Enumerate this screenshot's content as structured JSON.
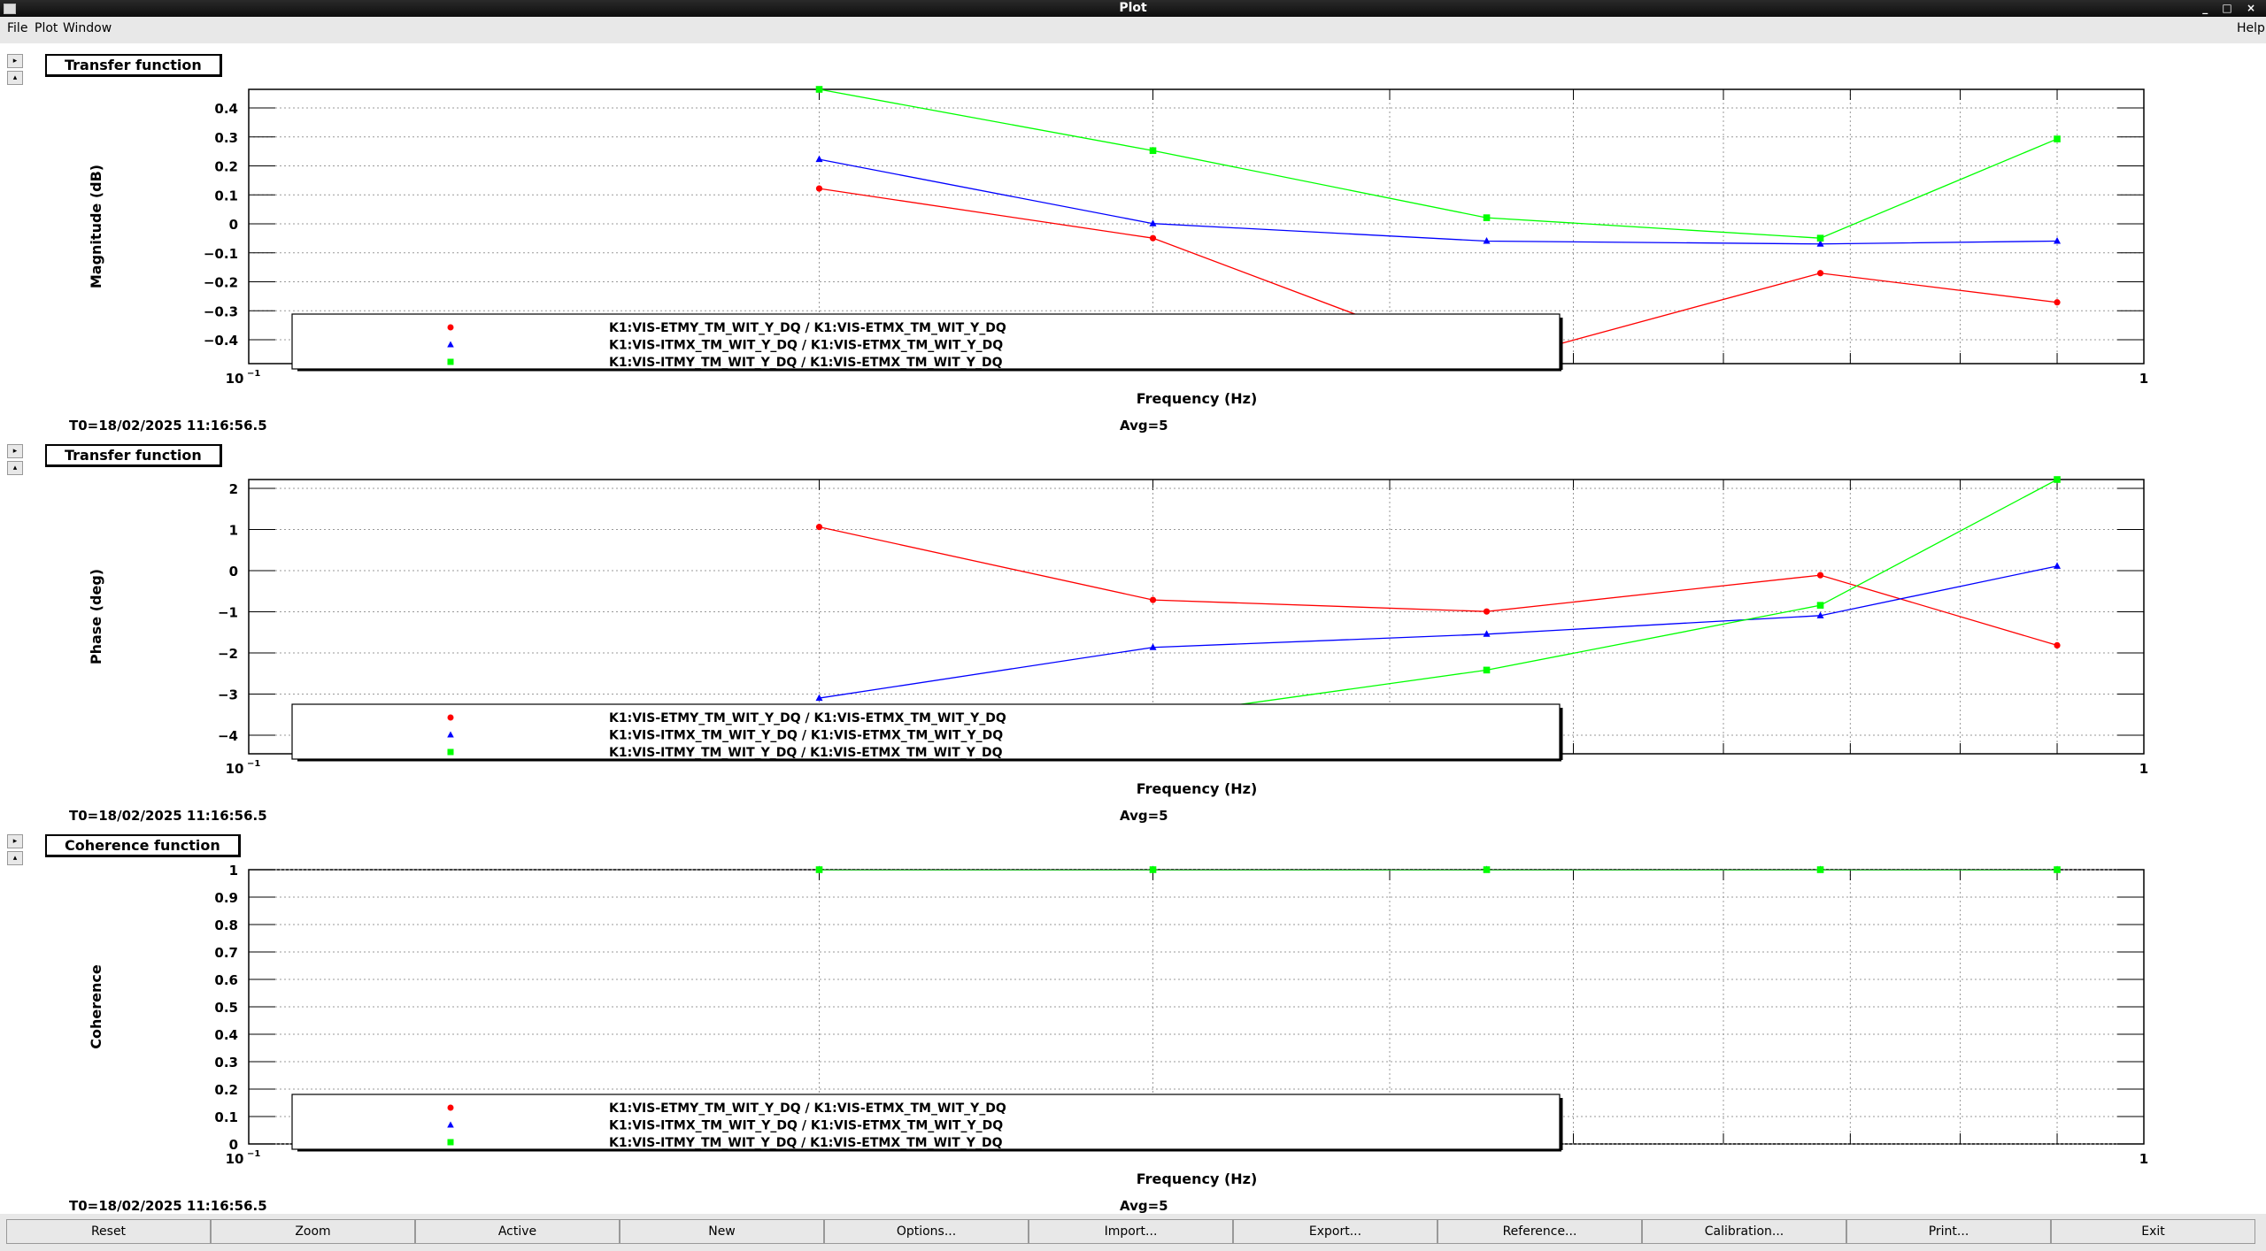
{
  "window": {
    "title": "Plot",
    "controls": "_ □ ×"
  },
  "menu": {
    "file": "File",
    "plot": "Plot",
    "window": "Window",
    "help": "Help"
  },
  "panels": [
    {
      "title": "Transfer function",
      "ylabel": "Magnitude (dB)",
      "xlabel": "Frequency (Hz)",
      "t0": "T0=18/02/2025 11:16:56.5",
      "avg": "Avg=5",
      "yticks": [
        "0.4",
        "0.3",
        "0.2",
        "0.1",
        "0",
        "−0.1",
        "−0.2",
        "−0.3",
        "−0.4"
      ]
    },
    {
      "title": "Transfer function",
      "ylabel": "Phase (deg)",
      "xlabel": "Frequency (Hz)",
      "t0": "T0=18/02/2025 11:16:56.5",
      "avg": "Avg=5",
      "yticks": [
        "2",
        "1",
        "0",
        "−1",
        "−2",
        "−3",
        "−4"
      ]
    },
    {
      "title": "Coherence function",
      "ylabel": "Coherence",
      "xlabel": "Frequency (Hz)",
      "t0": "T0=18/02/2025 11:16:56.5",
      "avg": "Avg=5",
      "yticks": [
        "1",
        "0.9",
        "0.8",
        "0.7",
        "0.6",
        "0.5",
        "0.4",
        "0.3",
        "0.2",
        "0.1",
        "0"
      ]
    }
  ],
  "legend": [
    "K1:VIS-ETMY_TM_WIT_Y_DQ / K1:VIS-ETMX_TM_WIT_Y_DQ",
    "K1:VIS-ITMX_TM_WIT_Y_DQ / K1:VIS-ETMX_TM_WIT_Y_DQ",
    "K1:VIS-ITMY_TM_WIT_Y_DQ / K1:VIS-ETMX_TM_WIT_Y_DQ"
  ],
  "xticks": {
    "left": "10",
    "left_exp": "−1",
    "right": "1"
  },
  "colors": {
    "red": "#ff0000",
    "blue": "#0000ff",
    "green": "#00ff00"
  },
  "chart_data": [
    {
      "type": "line",
      "title": "Transfer function",
      "xlabel": "Frequency (Hz)",
      "ylabel": "Magnitude (dB)",
      "xscale": "log",
      "xlim": [
        0.1,
        1
      ],
      "ylim": [
        -0.48,
        0.46
      ],
      "grid": true,
      "legend": "bottom-left",
      "x": [
        0.2,
        0.3,
        0.45,
        0.675,
        0.9
      ],
      "series": [
        {
          "name": "K1:VIS-ETMY_TM_WIT_Y_DQ / K1:VIS-ETMX_TM_WIT_Y_DQ",
          "color": "#ff0000",
          "marker": "circle",
          "values": [
            0.12,
            -0.05,
            -0.48,
            -0.17,
            -0.27
          ]
        },
        {
          "name": "K1:VIS-ITMX_TM_WIT_Y_DQ / K1:VIS-ETMX_TM_WIT_Y_DQ",
          "color": "#0000ff",
          "marker": "triangle",
          "values": [
            0.22,
            0.0,
            -0.06,
            -0.07,
            -0.06
          ]
        },
        {
          "name": "K1:VIS-ITMY_TM_WIT_Y_DQ / K1:VIS-ETMX_TM_WIT_Y_DQ",
          "color": "#00ff00",
          "marker": "square",
          "values": [
            0.46,
            0.25,
            0.02,
            -0.05,
            0.29
          ]
        }
      ]
    },
    {
      "type": "line",
      "title": "Transfer function",
      "xlabel": "Frequency (Hz)",
      "ylabel": "Phase (deg)",
      "xscale": "log",
      "xlim": [
        0.1,
        1
      ],
      "ylim": [
        -4,
        2.65
      ],
      "grid": true,
      "legend": "bottom-left",
      "x": [
        0.2,
        0.3,
        0.45,
        0.675,
        0.9
      ],
      "series": [
        {
          "name": "K1:VIS-ETMY_TM_WIT_Y_DQ / K1:VIS-ETMX_TM_WIT_Y_DQ",
          "color": "#ff0000",
          "marker": "circle",
          "values": [
            1.5,
            -0.27,
            -0.55,
            0.33,
            -1.37
          ]
        },
        {
          "name": "K1:VIS-ITMX_TM_WIT_Y_DQ / K1:VIS-ETMX_TM_WIT_Y_DQ",
          "color": "#0000ff",
          "marker": "triangle",
          "values": [
            -2.65,
            -1.42,
            -1.1,
            -0.65,
            0.55
          ]
        },
        {
          "name": "K1:VIS-ITMY_TM_WIT_Y_DQ / K1:VIS-ETMX_TM_WIT_Y_DQ",
          "color": "#00ff00",
          "marker": "square",
          "values": [
            -4.0,
            -3.1,
            -1.97,
            -0.4,
            2.65
          ]
        }
      ]
    },
    {
      "type": "line",
      "title": "Coherence function",
      "xlabel": "Frequency (Hz)",
      "ylabel": "Coherence",
      "xscale": "log",
      "xlim": [
        0.1,
        1
      ],
      "ylim": [
        0,
        1
      ],
      "grid": true,
      "legend": "bottom-left",
      "x": [
        0.2,
        0.3,
        0.45,
        0.675,
        0.9
      ],
      "series": [
        {
          "name": "K1:VIS-ETMY_TM_WIT_Y_DQ / K1:VIS-ETMX_TM_WIT_Y_DQ",
          "color": "#ff0000",
          "marker": "circle",
          "values": [
            1,
            1,
            1,
            1,
            1
          ]
        },
        {
          "name": "K1:VIS-ITMX_TM_WIT_Y_DQ / K1:VIS-ETMX_TM_WIT_Y_DQ",
          "color": "#0000ff",
          "marker": "triangle",
          "values": [
            1,
            1,
            1,
            1,
            1
          ]
        },
        {
          "name": "K1:VIS-ITMY_TM_WIT_Y_DQ / K1:VIS-ETMX_TM_WIT_Y_DQ",
          "color": "#00ff00",
          "marker": "square",
          "values": [
            1,
            1,
            1,
            1,
            1
          ]
        }
      ]
    }
  ],
  "buttons": [
    "Reset",
    "Zoom",
    "Active",
    "New",
    "Options...",
    "Import...",
    "Export...",
    "Reference...",
    "Calibration...",
    "Print...",
    "Exit"
  ]
}
